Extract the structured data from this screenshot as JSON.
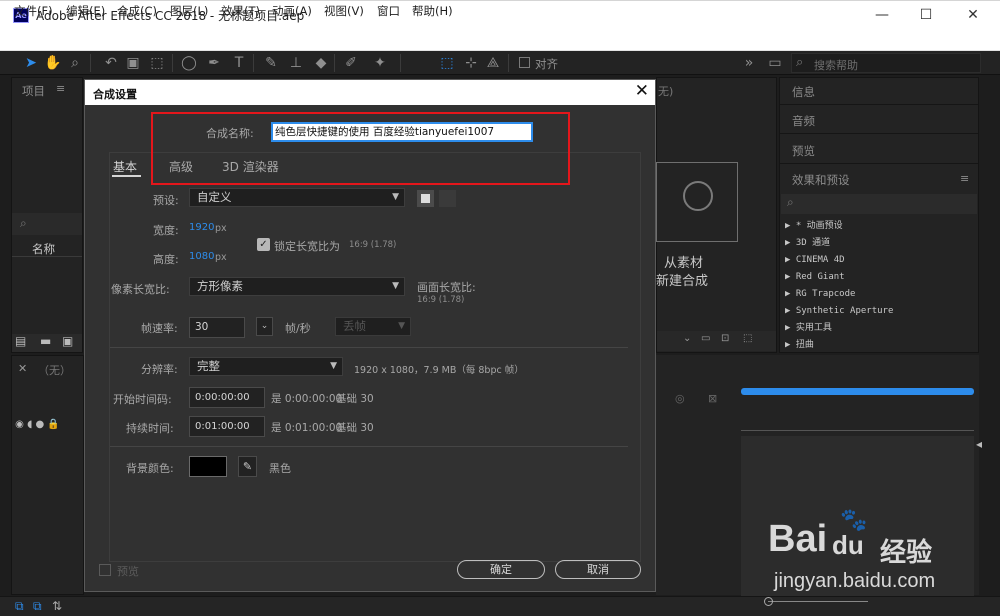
{
  "window": {
    "title": "Adobe After Effects CC 2018 - 无标题项目.aep",
    "logo": "Ae",
    "min": "—",
    "max": "☐",
    "close": "✕"
  },
  "menu": [
    "文件(F)",
    "编辑(E)",
    "合成(C)",
    "图层(L)",
    "效果(T)",
    "动画(A)",
    "视图(V)",
    "窗口",
    "帮助(H)"
  ],
  "toolbar": {
    "align_label": "对齐",
    "search_placeholder": "搜索帮助"
  },
  "project_panel": {
    "title": "项目",
    "column_name": "名称",
    "search_icon": "⌕"
  },
  "composition_panel": {
    "hint_line1": "从素材",
    "hint_line2": "新建合成",
    "none_label": "无)"
  },
  "right_panels": {
    "info": "信息",
    "audio": "音频",
    "preview": "预览",
    "effects": "效果和预设"
  },
  "effects_list": [
    "▶ * 动画预设",
    "▶ 3D 通道",
    "▶ CINEMA 4D",
    "▶ Red Giant",
    "▶ RG Trapcode",
    "▶ Synthetic Aperture",
    "▶ 实用工具",
    "▶ 扭曲"
  ],
  "timeline": {
    "none_label": "（无）"
  },
  "dialog": {
    "title": "合成设置",
    "name_label": "合成名称:",
    "name_value": "纯色层快捷键的使用 百度经验tianyuefei1007",
    "tabs": [
      "基本",
      "高级",
      "3D 渲染器"
    ],
    "preset_label": "预设:",
    "preset_value": "自定义",
    "width_label": "宽度:",
    "width_value": "1920",
    "width_unit": "px",
    "height_label": "高度:",
    "height_value": "1080",
    "height_unit": "px",
    "lock_label": "锁定长宽比为",
    "lock_ratio": "16:9 (1.78)",
    "lock_checked": true,
    "pixel_aspect_label": "像素长宽比:",
    "pixel_aspect_value": "方形像素",
    "frame_aspect_label": "画面长宽比:",
    "frame_aspect_value": "16:9 (1.78)",
    "fps_label": "帧速率:",
    "fps_value": "30",
    "fps_unit": "帧/秒",
    "drop_frame": "丢帧",
    "resolution_label": "分辨率:",
    "resolution_value": "完整",
    "resolution_info": "1920 x 1080，7.9 MB（每 8bpc 帧）",
    "start_label": "开始时间码:",
    "start_value": "0:00:00:00",
    "start_note": "是 0:00:00:00",
    "start_base": "基础 30",
    "duration_label": "持续时间:",
    "duration_value": "0:01:00:00",
    "duration_note": "是 0:01:00:00",
    "duration_base": "基础 30",
    "bg_label": "背景颜色:",
    "bg_name": "黑色",
    "bg_color": "#000000",
    "preview_label": "预览",
    "ok_label": "确定",
    "cancel_label": "取消"
  },
  "watermark": {
    "brand": "Bai",
    "brand2": "du",
    "jingyan": "经验",
    "url": "jingyan.baidu.com"
  },
  "colors": {
    "accent_blue": "#2d8ceb",
    "highlight_red": "#e4161b",
    "timeline_blue": "#2d8ceb"
  }
}
